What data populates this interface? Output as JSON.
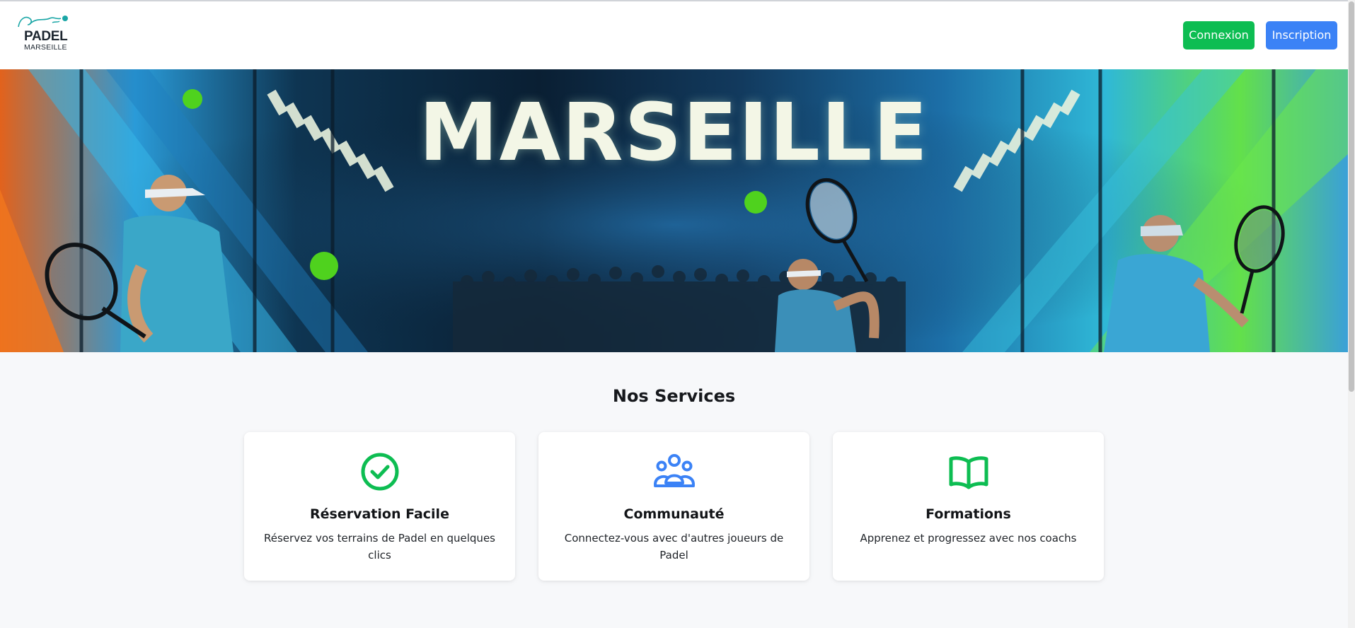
{
  "brand": {
    "logo_word": "PADEL",
    "logo_sub": "MARSEILLE",
    "logo_icon": "padel-player-swoosh-icon",
    "accent": "#1aa6a6"
  },
  "nav": {
    "login_label": "Connexion",
    "signup_label": "Inscription",
    "login_color": "#0dbd52",
    "signup_color": "#3b82f6"
  },
  "hero": {
    "title": "MARSEILLE"
  },
  "services": {
    "heading": "Nos Services",
    "items": [
      {
        "icon": "check-circle-icon",
        "icon_color": "#0dbd52",
        "title": "Réservation Facile",
        "description": "Réservez vos terrains de Padel en quelques clics"
      },
      {
        "icon": "users-group-icon",
        "icon_color": "#3b82f6",
        "title": "Communauté",
        "description": "Connectez-vous avec d'autres joueurs de Padel"
      },
      {
        "icon": "open-book-icon",
        "icon_color": "#0dbd52",
        "title": "Formations",
        "description": "Apprenez et progressez avec nos coachs"
      }
    ]
  }
}
